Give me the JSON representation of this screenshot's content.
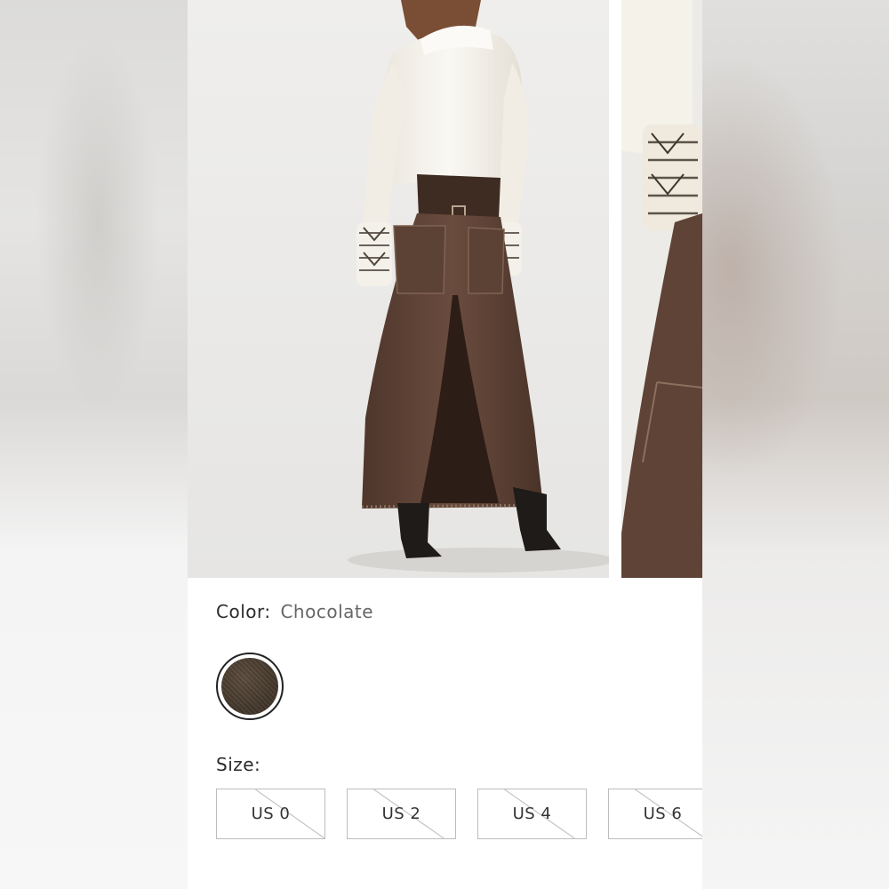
{
  "product": {
    "color_label": "Color:",
    "color_value": "Chocolate",
    "swatch_color": "#43372b",
    "size_label": "Size:",
    "sizes": [
      {
        "label": "US 0",
        "available": false
      },
      {
        "label": "US 2",
        "available": false
      },
      {
        "label": "US 4",
        "available": false
      },
      {
        "label": "US 6",
        "available": false
      }
    ]
  },
  "gallery": {
    "images": [
      {
        "name": "model-back-view-photo"
      },
      {
        "name": "skirt-detail-photo"
      }
    ]
  },
  "colors": {
    "skirt": "#5a4033",
    "shirt": "#f6f3ec",
    "boots": "#1e1b19",
    "border_unavailable": "#bdbdbd"
  }
}
